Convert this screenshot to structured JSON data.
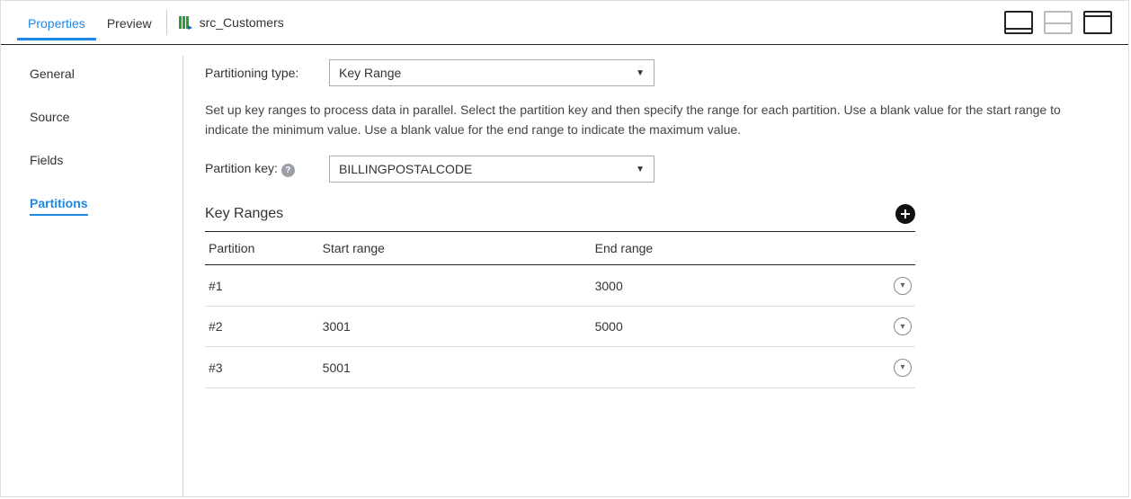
{
  "topTabs": {
    "properties": "Properties",
    "preview": "Preview"
  },
  "breadcrumb": {
    "label": "src_Customers"
  },
  "sidebar": {
    "items": [
      {
        "label": "General"
      },
      {
        "label": "Source"
      },
      {
        "label": "Fields"
      },
      {
        "label": "Partitions"
      }
    ]
  },
  "form": {
    "partitioningTypeLabel": "Partitioning type:",
    "partitioningTypeValue": "Key Range",
    "help": "Set up key ranges to process data in parallel. Select the partition key and then specify the range for each partition. Use a blank value for the start range to indicate the minimum value. Use a blank value for the end range to indicate the maximum value.",
    "partitionKeyLabel": "Partition key:",
    "partitionKeyValue": "BILLINGPOSTALCODE"
  },
  "keyRanges": {
    "title": "Key Ranges",
    "columns": {
      "partition": "Partition",
      "start": "Start range",
      "end": "End range"
    },
    "rows": [
      {
        "partition": "#1",
        "start": "",
        "end": "3000"
      },
      {
        "partition": "#2",
        "start": "3001",
        "end": "5000"
      },
      {
        "partition": "#3",
        "start": "5001",
        "end": ""
      }
    ]
  }
}
